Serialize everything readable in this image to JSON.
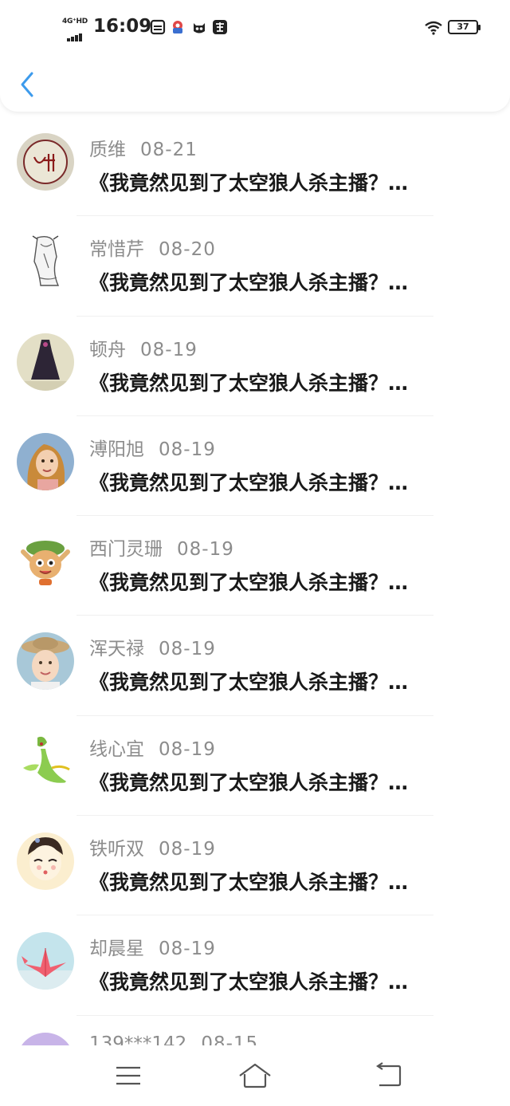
{
  "status_bar": {
    "network_label": "4G⁺HD",
    "time": "16:09",
    "battery_level": "37",
    "icons": [
      "sim-card-icon",
      "app-notification-icon",
      "cat-face-icon",
      "app-badge-icon",
      "wifi-icon",
      "battery-icon"
    ]
  },
  "header": {
    "back_icon": "chevron-left-icon",
    "accent_color": "#3d9bec"
  },
  "comments": [
    {
      "name": "质维",
      "date": "08-21",
      "message": "《我竟然见到了太空狼人杀主播？…",
      "avatar": "hand-drawn-circle-avatar"
    },
    {
      "name": "常惜芹",
      "date": "08-20",
      "message": "《我竟然见到了太空狼人杀主播？…",
      "avatar": "sketch-figure-avatar"
    },
    {
      "name": "顿舟",
      "date": "08-19",
      "message": "《我竟然见到了太空狼人杀主播？…",
      "avatar": "dress-avatar"
    },
    {
      "name": "溥阳旭",
      "date": "08-19",
      "message": "《我竟然见到了太空狼人杀主播？…",
      "avatar": "girl-photo-avatar"
    },
    {
      "name": "西门灵珊",
      "date": "08-19",
      "message": "《我竟然见到了太空狼人杀主播？…",
      "avatar": "cartoon-character-avatar"
    },
    {
      "name": "浑天禄",
      "date": "08-19",
      "message": "《我竟然见到了太空狼人杀主播？…",
      "avatar": "child-hat-photo-avatar"
    },
    {
      "name": "线心宜",
      "date": "08-19",
      "message": "《我竟然见到了太空狼人杀主播？…",
      "avatar": "green-creature-avatar"
    },
    {
      "name": "铁听双",
      "date": "08-19",
      "message": "《我竟然见到了太空狼人杀主播？…",
      "avatar": "anime-face-avatar"
    },
    {
      "name": "却晨星",
      "date": "08-19",
      "message": "《我竟然见到了太空狼人杀主播？…",
      "avatar": "paper-crane-avatar"
    },
    {
      "name": "139***142",
      "date": "08-15",
      "message": "",
      "avatar": "purple-avatar"
    }
  ],
  "bottom_nav": {
    "icons": [
      "menu-icon",
      "home-icon",
      "back-nav-icon"
    ]
  }
}
